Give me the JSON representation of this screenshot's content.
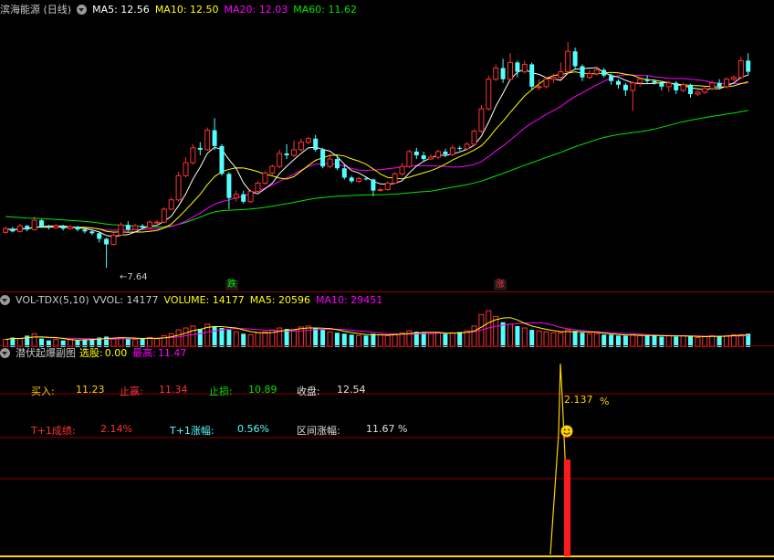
{
  "main_header": {
    "title": "滨海能源 (日线)",
    "ma5_label": "MA5: 12.56",
    "ma10_label": "MA10: 12.50",
    "ma20_label": "MA20: 12.03",
    "ma60_label": "MA60: 11.62"
  },
  "vol_header": {
    "name": "VOL-TDX(5,10)",
    "vvol": "VVOL: 14177",
    "volume": "VOLUME: 14177",
    "ma5": "MA5: 20596",
    "ma10": "MA10: 29451"
  },
  "ind_header": {
    "name": "潜伏起爆副图",
    "pick_label": "选股:",
    "pick_value": "0.00",
    "high_label": "最高:",
    "high_value": "11.47"
  },
  "annotations": {
    "low_price": "←7.64",
    "fall_tag": "跌",
    "rise_tag": "涨"
  },
  "info": {
    "buy_label": "买入:",
    "buy_value": "11.23",
    "take_profit_label": "止赢:",
    "take_profit_value": "11.34",
    "stop_loss_label": "止损:",
    "stop_loss_value": "10.89",
    "close_label": "收盘:",
    "close_value": "12.54",
    "t1_success_label": "T+1成绩:",
    "t1_success_value": "2.14%",
    "t1_rise_label": "T+1涨幅:",
    "t1_rise_value": "0.56%",
    "range_rise_label": "区间涨幅:",
    "range_rise_value": "11.67 %",
    "peak_label": "2.137",
    "peak_unit": "%"
  },
  "colors": {
    "up": "#ff3232",
    "down": "#54ffff",
    "ma5": "#ffffff",
    "ma10": "#ffff00",
    "ma20": "#ff00ff",
    "ma60": "#00e600",
    "label_gold": "#ffd200",
    "label_green": "#00e600",
    "label_cyan": "#54ffff",
    "label_red": "#ff3232",
    "label_magenta": "#ff00ff",
    "separator": "#8b0000"
  },
  "chart_data": {
    "type": "candlestick",
    "candles": [
      [
        9.55,
        9.75,
        9.5,
        9.85
      ],
      [
        9.75,
        9.6,
        9.55,
        9.85
      ],
      [
        9.6,
        9.9,
        9.55,
        10.0
      ],
      [
        9.9,
        9.7,
        9.6,
        9.95
      ],
      [
        9.7,
        10.2,
        9.65,
        10.4
      ],
      [
        10.2,
        9.85,
        9.8,
        10.25
      ],
      [
        9.85,
        9.8,
        9.7,
        9.95
      ],
      [
        9.8,
        9.9,
        9.75,
        10.0
      ],
      [
        9.9,
        9.75,
        9.65,
        9.95
      ],
      [
        9.75,
        9.85,
        9.7,
        9.95
      ],
      [
        9.85,
        9.7,
        9.6,
        9.9
      ],
      [
        9.7,
        9.6,
        9.5,
        9.75
      ],
      [
        9.6,
        9.5,
        9.4,
        9.65
      ],
      [
        9.5,
        9.2,
        9.0,
        9.55
      ],
      [
        9.2,
        8.9,
        7.64,
        9.25
      ],
      [
        8.9,
        9.4,
        8.85,
        9.5
      ],
      [
        9.4,
        9.95,
        9.35,
        10.1
      ],
      [
        9.95,
        9.7,
        9.6,
        10.15
      ],
      [
        9.7,
        9.9,
        9.65,
        10.0
      ],
      [
        9.9,
        9.8,
        9.75,
        10.0
      ],
      [
        9.8,
        10.1,
        9.75,
        10.2
      ],
      [
        10.1,
        10.1,
        10.0,
        10.2
      ],
      [
        10.1,
        10.8,
        10.05,
        10.9
      ],
      [
        10.8,
        11.3,
        10.75,
        11.45
      ],
      [
        11.3,
        12.6,
        11.2,
        12.8
      ],
      [
        12.6,
        13.3,
        12.5,
        13.6
      ],
      [
        13.3,
        14.1,
        13.2,
        14.3
      ],
      [
        14.1,
        14.0,
        13.7,
        14.4
      ],
      [
        14.0,
        15.05,
        13.95,
        15.2
      ],
      [
        15.05,
        14.2,
        14.0,
        15.7
      ],
      [
        14.2,
        12.7,
        12.6,
        14.3
      ],
      [
        12.7,
        11.4,
        10.8,
        12.8
      ],
      [
        11.4,
        11.6,
        11.2,
        11.8
      ],
      [
        11.6,
        11.2,
        11.1,
        11.8
      ],
      [
        11.2,
        11.75,
        11.15,
        11.85
      ],
      [
        11.75,
        12.2,
        11.7,
        12.3
      ],
      [
        12.2,
        12.75,
        12.1,
        12.85
      ],
      [
        12.75,
        13.1,
        12.65,
        13.2
      ],
      [
        13.1,
        13.8,
        13.0,
        14.0
      ],
      [
        13.8,
        13.7,
        13.5,
        14.3
      ],
      [
        13.7,
        14.0,
        13.6,
        14.5
      ],
      [
        14.0,
        14.4,
        13.9,
        14.6
      ],
      [
        14.4,
        14.6,
        14.3,
        14.7
      ],
      [
        14.6,
        14.0,
        13.9,
        14.8
      ],
      [
        14.0,
        13.1,
        13.0,
        14.1
      ],
      [
        13.1,
        13.5,
        13.0,
        13.8
      ],
      [
        13.5,
        13.0,
        12.9,
        13.6
      ],
      [
        13.0,
        12.5,
        12.4,
        13.2
      ],
      [
        12.5,
        12.3,
        12.2,
        12.6
      ],
      [
        12.3,
        12.45,
        12.2,
        12.55
      ],
      [
        12.45,
        12.4,
        12.35,
        12.5
      ],
      [
        12.4,
        11.8,
        11.5,
        12.45
      ],
      [
        11.8,
        11.85,
        11.75,
        11.95
      ],
      [
        11.85,
        12.2,
        11.8,
        12.3
      ],
      [
        12.2,
        12.7,
        12.15,
        12.8
      ],
      [
        12.7,
        13.1,
        12.6,
        13.3
      ],
      [
        13.1,
        13.9,
        13.0,
        14.0
      ],
      [
        13.9,
        13.7,
        13.5,
        14.1
      ],
      [
        13.7,
        13.5,
        13.4,
        13.9
      ],
      [
        13.5,
        13.6,
        13.45,
        13.75
      ],
      [
        13.6,
        13.9,
        13.5,
        14.0
      ],
      [
        13.9,
        13.75,
        13.6,
        14.05
      ],
      [
        13.75,
        14.1,
        13.65,
        14.25
      ],
      [
        14.1,
        14.05,
        13.95,
        14.2
      ],
      [
        14.05,
        14.3,
        14.0,
        14.4
      ],
      [
        14.3,
        15.0,
        14.2,
        15.1
      ],
      [
        15.0,
        16.2,
        14.9,
        16.4
      ],
      [
        16.2,
        17.8,
        16.1,
        18.0
      ],
      [
        17.8,
        18.4,
        17.7,
        18.6
      ],
      [
        18.4,
        17.8,
        17.6,
        18.9
      ],
      [
        17.8,
        18.7,
        17.7,
        19.2
      ],
      [
        18.7,
        18.2,
        17.9,
        18.8
      ],
      [
        18.2,
        18.6,
        18.1,
        18.8
      ],
      [
        18.6,
        17.4,
        17.2,
        18.7
      ],
      [
        17.4,
        17.4,
        17.2,
        17.8
      ],
      [
        17.4,
        17.8,
        17.3,
        17.9
      ],
      [
        17.8,
        17.9,
        17.6,
        18.1
      ],
      [
        17.9,
        18.2,
        17.8,
        18.7
      ],
      [
        18.2,
        19.3,
        18.1,
        19.8
      ],
      [
        19.3,
        18.5,
        18.3,
        19.5
      ],
      [
        18.5,
        17.9,
        17.7,
        18.6
      ],
      [
        17.9,
        18.1,
        17.8,
        18.3
      ],
      [
        18.1,
        18.3,
        18.0,
        18.5
      ],
      [
        18.3,
        18.0,
        17.9,
        18.4
      ],
      [
        18.0,
        17.7,
        17.5,
        18.1
      ],
      [
        17.7,
        17.5,
        17.3,
        17.8
      ],
      [
        17.5,
        17.2,
        16.9,
        17.6
      ],
      [
        17.2,
        17.6,
        16.1,
        17.7
      ],
      [
        17.6,
        17.8,
        17.4,
        17.9
      ],
      [
        17.8,
        17.7,
        17.6,
        18.0
      ],
      [
        17.7,
        17.6,
        17.5,
        17.8
      ],
      [
        17.6,
        17.4,
        17.2,
        17.7
      ],
      [
        17.4,
        17.6,
        17.1,
        17.7
      ],
      [
        17.6,
        17.2,
        17.0,
        17.7
      ],
      [
        17.2,
        17.5,
        17.1,
        17.6
      ],
      [
        17.5,
        17.0,
        16.8,
        17.55
      ],
      [
        17.0,
        17.1,
        16.9,
        17.2
      ],
      [
        17.1,
        17.3,
        17.0,
        17.4
      ],
      [
        17.3,
        17.6,
        17.2,
        17.7
      ],
      [
        17.6,
        17.4,
        17.3,
        17.8
      ],
      [
        17.4,
        17.8,
        17.3,
        17.9
      ],
      [
        17.8,
        17.9,
        17.7,
        18.0
      ],
      [
        17.9,
        18.8,
        17.8,
        19.0
      ],
      [
        18.8,
        18.2,
        18.0,
        19.2
      ]
    ],
    "volume": [
      8,
      10,
      9,
      12,
      14,
      9,
      7,
      8,
      7,
      8,
      7,
      8,
      9,
      10,
      11,
      9,
      10,
      9,
      8,
      9,
      10,
      9,
      12,
      14,
      18,
      20,
      22,
      19,
      24,
      22,
      20,
      18,
      16,
      14,
      13,
      15,
      16,
      18,
      20,
      19,
      18,
      21,
      22,
      20,
      18,
      16,
      15,
      14,
      13,
      12,
      12,
      14,
      13,
      12,
      14,
      15,
      17,
      16,
      15,
      14,
      15,
      14,
      15,
      16,
      17,
      22,
      34,
      38,
      32,
      26,
      24,
      22,
      20,
      18,
      17,
      16,
      15,
      15,
      18,
      17,
      15,
      14,
      14,
      13,
      13,
      12,
      12,
      13,
      12,
      12,
      12,
      11,
      12,
      11,
      12,
      11,
      10,
      11,
      12,
      12,
      12,
      13,
      13,
      14
    ],
    "volume_ma5": 20596,
    "volume_ma10": 29451,
    "low_annotation_value": 7.64,
    "indicator": {
      "pick": 0.0,
      "high": 11.47,
      "peak_value": 2.137
    }
  }
}
